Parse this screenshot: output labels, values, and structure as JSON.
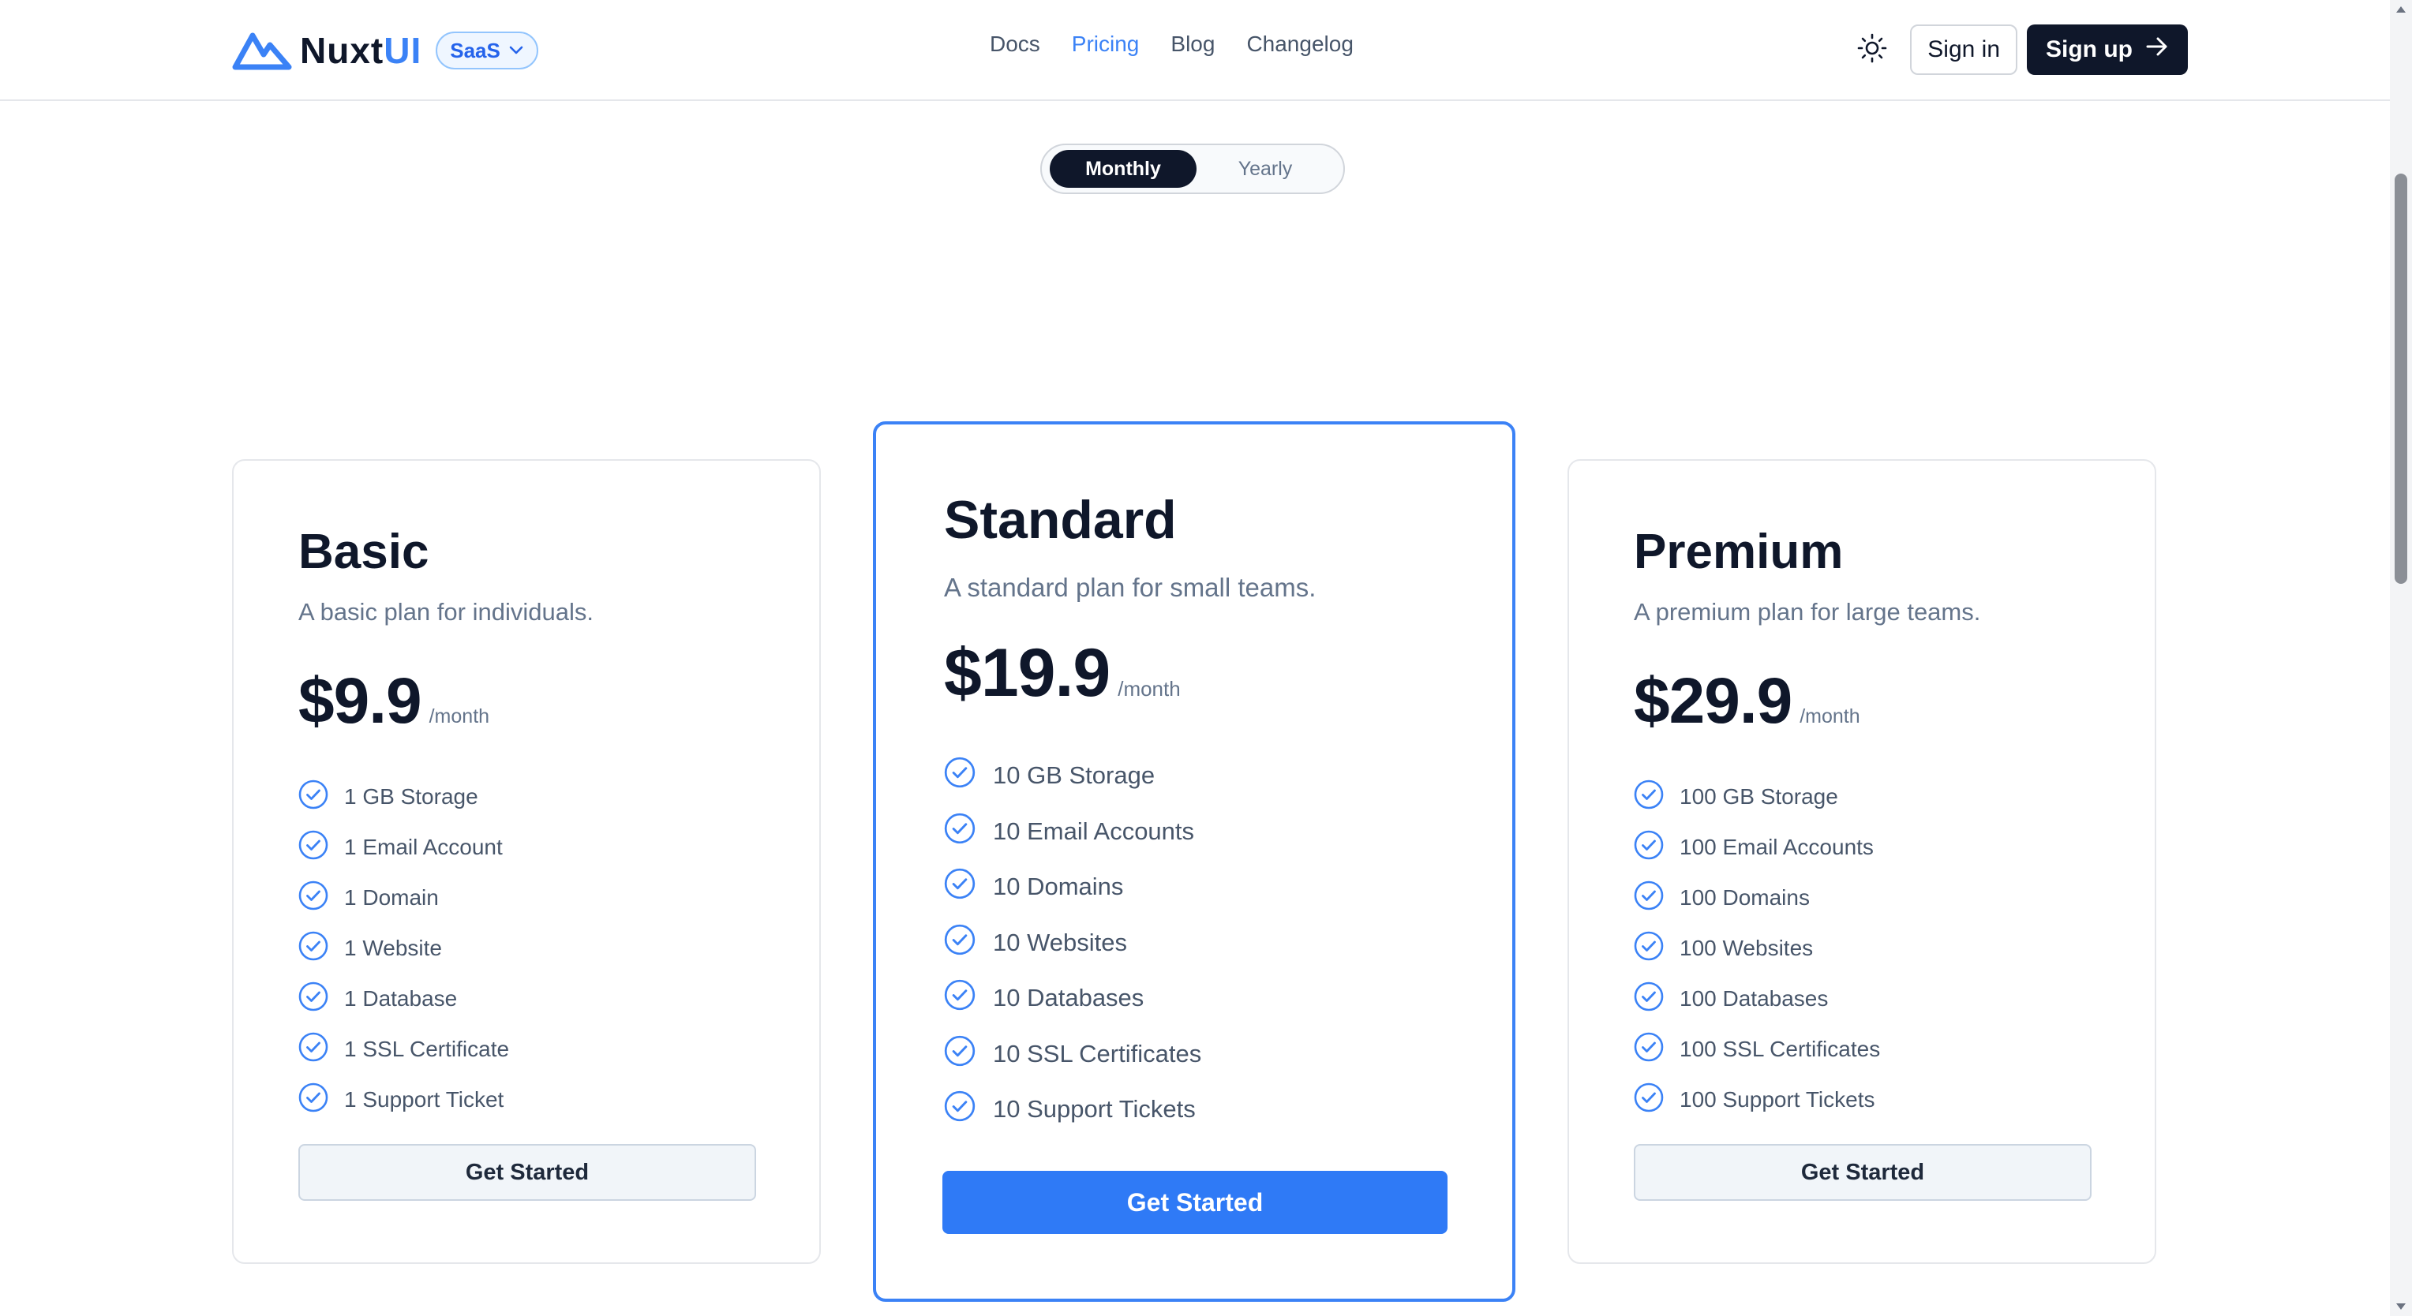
{
  "header": {
    "logo_main": "Nuxt",
    "logo_accent": "UI",
    "template_badge": "SaaS",
    "nav": [
      {
        "label": "Docs",
        "active": false
      },
      {
        "label": "Pricing",
        "active": true
      },
      {
        "label": "Blog",
        "active": false
      },
      {
        "label": "Changelog",
        "active": false
      }
    ],
    "theme_icon": "sun-icon",
    "signin_label": "Sign in",
    "signup_label": "Sign up"
  },
  "billing_toggle": {
    "options": [
      "Monthly",
      "Yearly"
    ],
    "selected": "Monthly"
  },
  "plans": [
    {
      "name": "Basic",
      "description": "A basic plan for individuals.",
      "price": "$9.9",
      "period": "/month",
      "highlighted": false,
      "features": [
        "1 GB Storage",
        "1 Email Account",
        "1 Domain",
        "1 Website",
        "1 Database",
        "1 SSL Certificate",
        "1 Support Ticket"
      ],
      "cta": "Get Started"
    },
    {
      "name": "Standard",
      "description": "A standard plan for small teams.",
      "price": "$19.9",
      "period": "/month",
      "highlighted": true,
      "features": [
        "10 GB Storage",
        "10 Email Accounts",
        "10 Domains",
        "10 Websites",
        "10 Databases",
        "10 SSL Certificates",
        "10 Support Tickets"
      ],
      "cta": "Get Started"
    },
    {
      "name": "Premium",
      "description": "A premium plan for large teams.",
      "price": "$29.9",
      "period": "/month",
      "highlighted": false,
      "features": [
        "100 GB Storage",
        "100 Email Accounts",
        "100 Domains",
        "100 Websites",
        "100 Databases",
        "100 SSL Certificates",
        "100 Support Tickets"
      ],
      "cta": "Get Started"
    }
  ],
  "colors": {
    "accent": "#3b82f6",
    "primary_button": "#2f7af6",
    "dark": "#0f172a",
    "muted_text": "#64748b"
  }
}
